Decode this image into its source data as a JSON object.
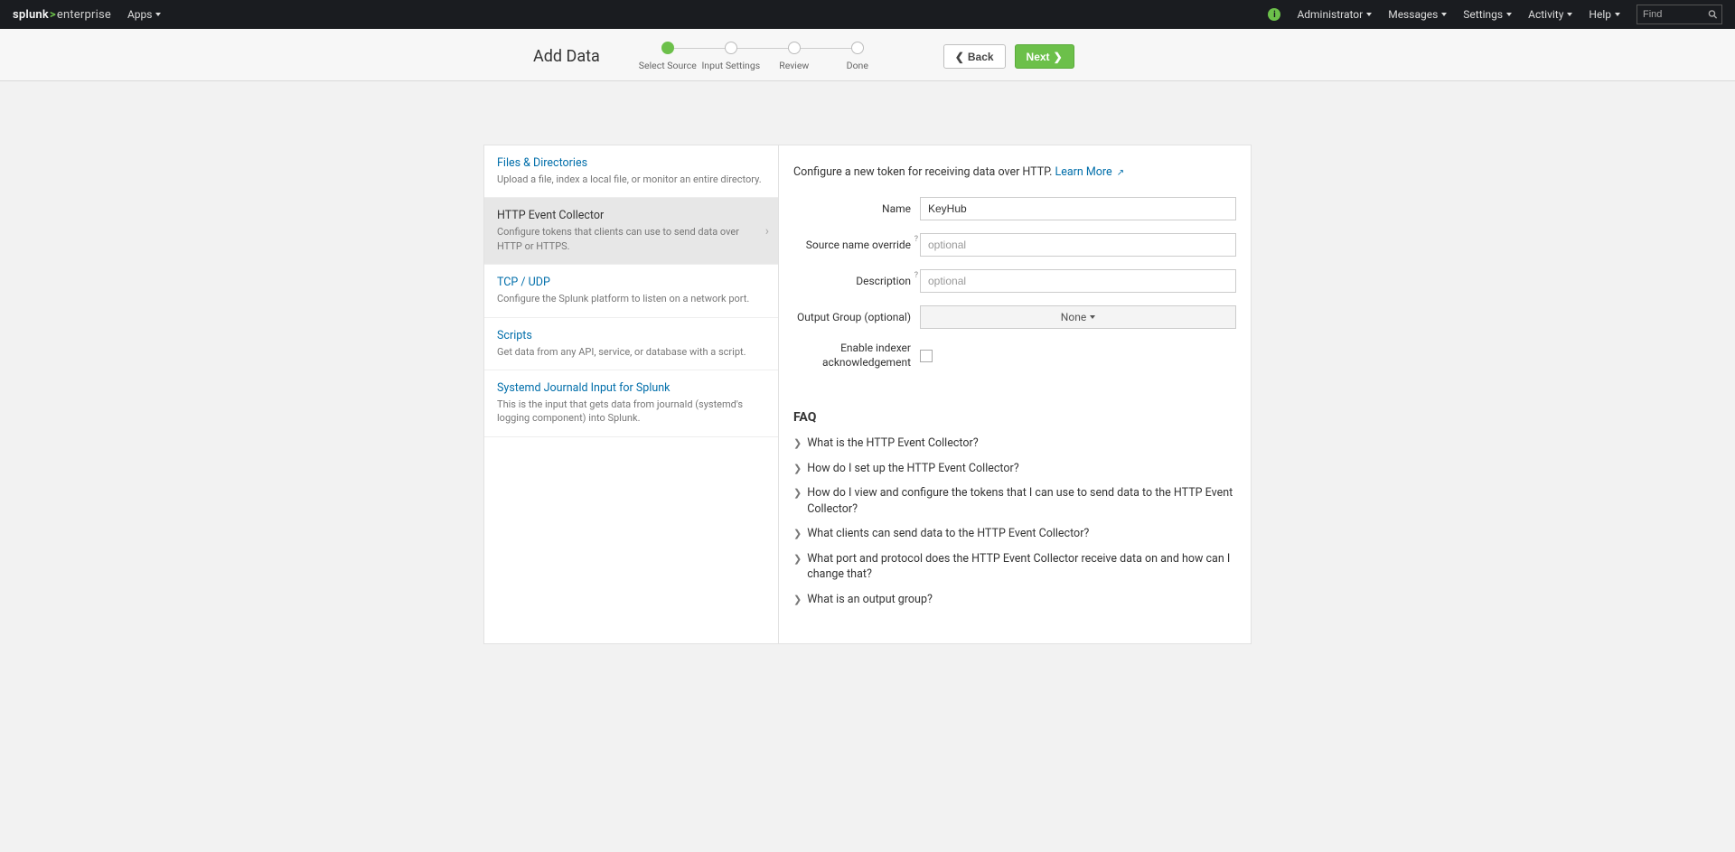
{
  "topbar": {
    "brand_prefix": "splunk",
    "brand_suffix": "enterprise",
    "apps": "Apps",
    "admin": "Administrator",
    "messages": "Messages",
    "settings": "Settings",
    "activity": "Activity",
    "help": "Help",
    "find_placeholder": "Find"
  },
  "subheader": {
    "title": "Add Data",
    "steps": [
      "Select Source",
      "Input Settings",
      "Review",
      "Done"
    ],
    "back": "Back",
    "next": "Next"
  },
  "sources": [
    {
      "title": "Files & Directories",
      "desc": "Upload a file, index a local file, or monitor an entire directory."
    },
    {
      "title": "HTTP Event Collector",
      "desc": "Configure tokens that clients can use to send data over HTTP or HTTPS."
    },
    {
      "title": "TCP / UDP",
      "desc": "Configure the Splunk platform to listen on a network port."
    },
    {
      "title": "Scripts",
      "desc": "Get data from any API, service, or database with a script."
    },
    {
      "title": "Systemd Journald Input for Splunk",
      "desc": "This is the input that gets data from journald (systemd's logging component) into Splunk."
    }
  ],
  "right": {
    "intro_text": "Configure a new token for receiving data over HTTP. ",
    "learn_more": "Learn More",
    "labels": {
      "name": "Name",
      "source_override": "Source name override",
      "description": "Description",
      "output_group": "Output Group (optional)",
      "enable_ack": "Enable indexer acknowledgement"
    },
    "values": {
      "name": "KeyHub",
      "source_override": "",
      "description": "",
      "output_group_selected": "None"
    },
    "placeholders": {
      "optional": "optional"
    },
    "faq_title": "FAQ",
    "faq": [
      "What is the HTTP Event Collector?",
      "How do I set up the HTTP Event Collector?",
      "How do I view and configure the tokens that I can use to send data to the HTTP Event Collector?",
      "What clients can send data to the HTTP Event Collector?",
      "What port and protocol does the HTTP Event Collector receive data on and how can I change that?",
      "What is an output group?"
    ]
  }
}
